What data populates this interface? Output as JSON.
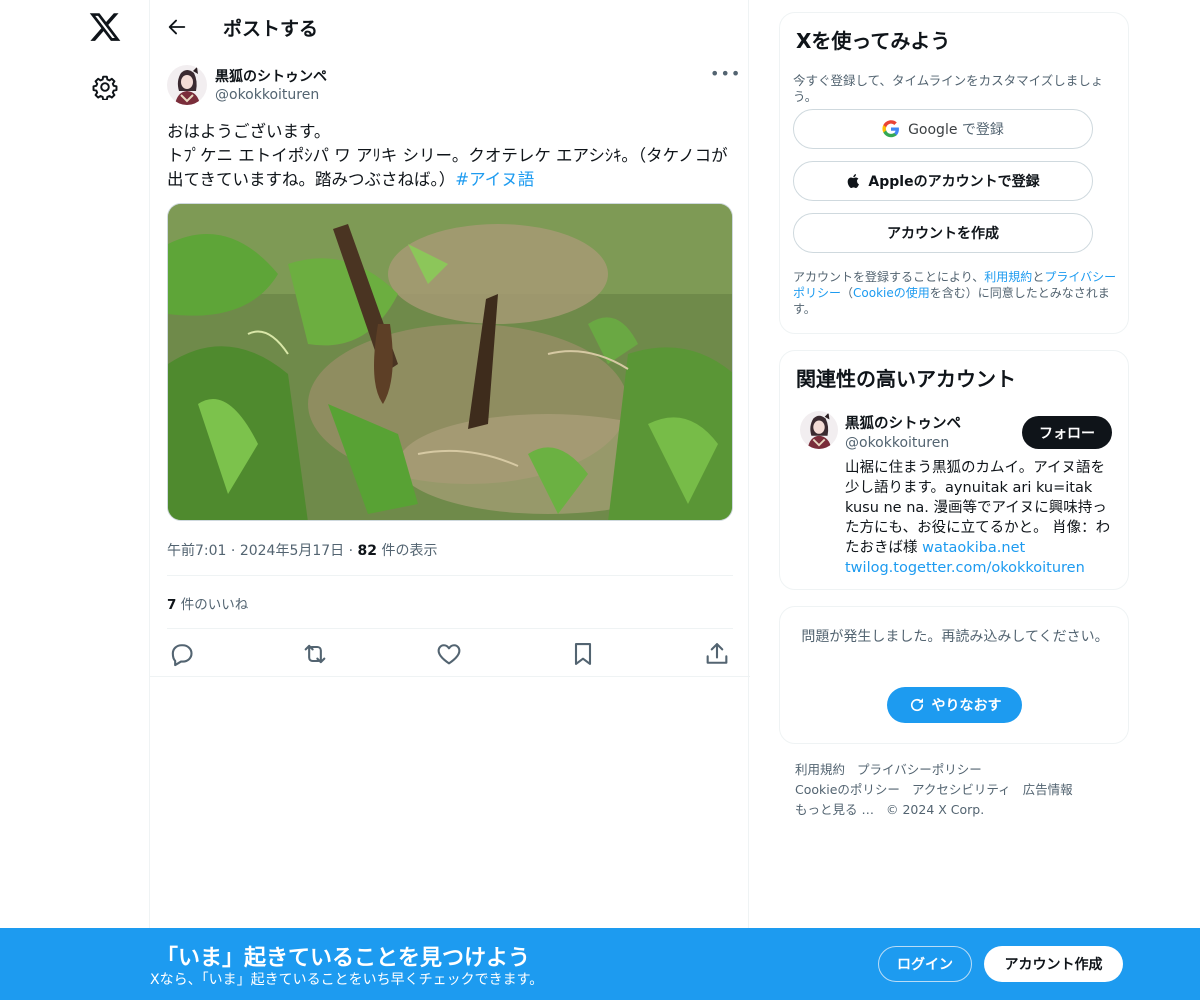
{
  "header": {
    "title": "ポストする"
  },
  "post": {
    "author_name": "黒狐のシトゥンペ",
    "author_handle": "@okokkoituren",
    "text_line1": "おはようございます。",
    "text_line2": "トﾌﾟケニ エトイポｼパ ワ アﾘキ シリー。クオテレケ エアシｼｷ。（タケノコが出てきていますね。踏みつぶさねば。）",
    "hashtag": "#アイヌ語",
    "time": "午前7:01",
    "date": "2024年5月17日",
    "views_count": "82",
    "views_label": "件の表示",
    "likes_count": "7",
    "likes_label": "件のいいね"
  },
  "signup_card": {
    "title": "Xを使ってみよう",
    "subtitle": "今すぐ登録して、タイムラインをカスタマイズしましょう。",
    "google_brand": "Google",
    "google_suffix": "で登録",
    "apple_label": "Appleのアカウントで登録",
    "create_label": "アカウントを作成",
    "legal_prefix": "アカウントを登録することにより、",
    "terms_link": "利用規約",
    "legal_and": "と",
    "privacy_link": "プライバシーポリシー",
    "legal_paren_open": "（",
    "cookie_link": "Cookieの使用",
    "legal_suffix": "を含む）に同意したとみなされます。"
  },
  "related_card": {
    "title": "関連性の高いアカウント",
    "name": "黒狐のシトゥンペ",
    "handle": "@okokkoituren",
    "follow_label": "フォロー",
    "bio": "山裾に住まう黒狐のカムイ。アイヌ語を少し語ります。aynuitak ari ku=itak kusu ne na. 漫画等でアイヌに興味持った方にも、お役に立てるかと。 肖像：わたおきば様 ",
    "bio_link1": "wataokiba.net",
    "bio_link2": "twilog.togetter.com/okokkoituren"
  },
  "error_card": {
    "message": "問題が発生しました。再読み込みしてください。",
    "retry_label": "やりなおす"
  },
  "footer": {
    "terms": "利用規約",
    "privacy": "プライバシーポリシー",
    "cookie": "Cookieのポリシー",
    "accessibility": "アクセシビリティ",
    "ads": "広告情報",
    "more": "もっと見る …",
    "copyright": "© 2024 X Corp."
  },
  "bottom_bar": {
    "title": "「いま」起きていることを見つけよう",
    "subtitle": "Xなら、「いま」起きていることをいち早くチェックできます。",
    "login_label": "ログイン",
    "signup_label": "アカウント作成"
  },
  "colors": {
    "accent": "#1d9bf0",
    "text": "#0f1419",
    "muted": "#536471"
  }
}
